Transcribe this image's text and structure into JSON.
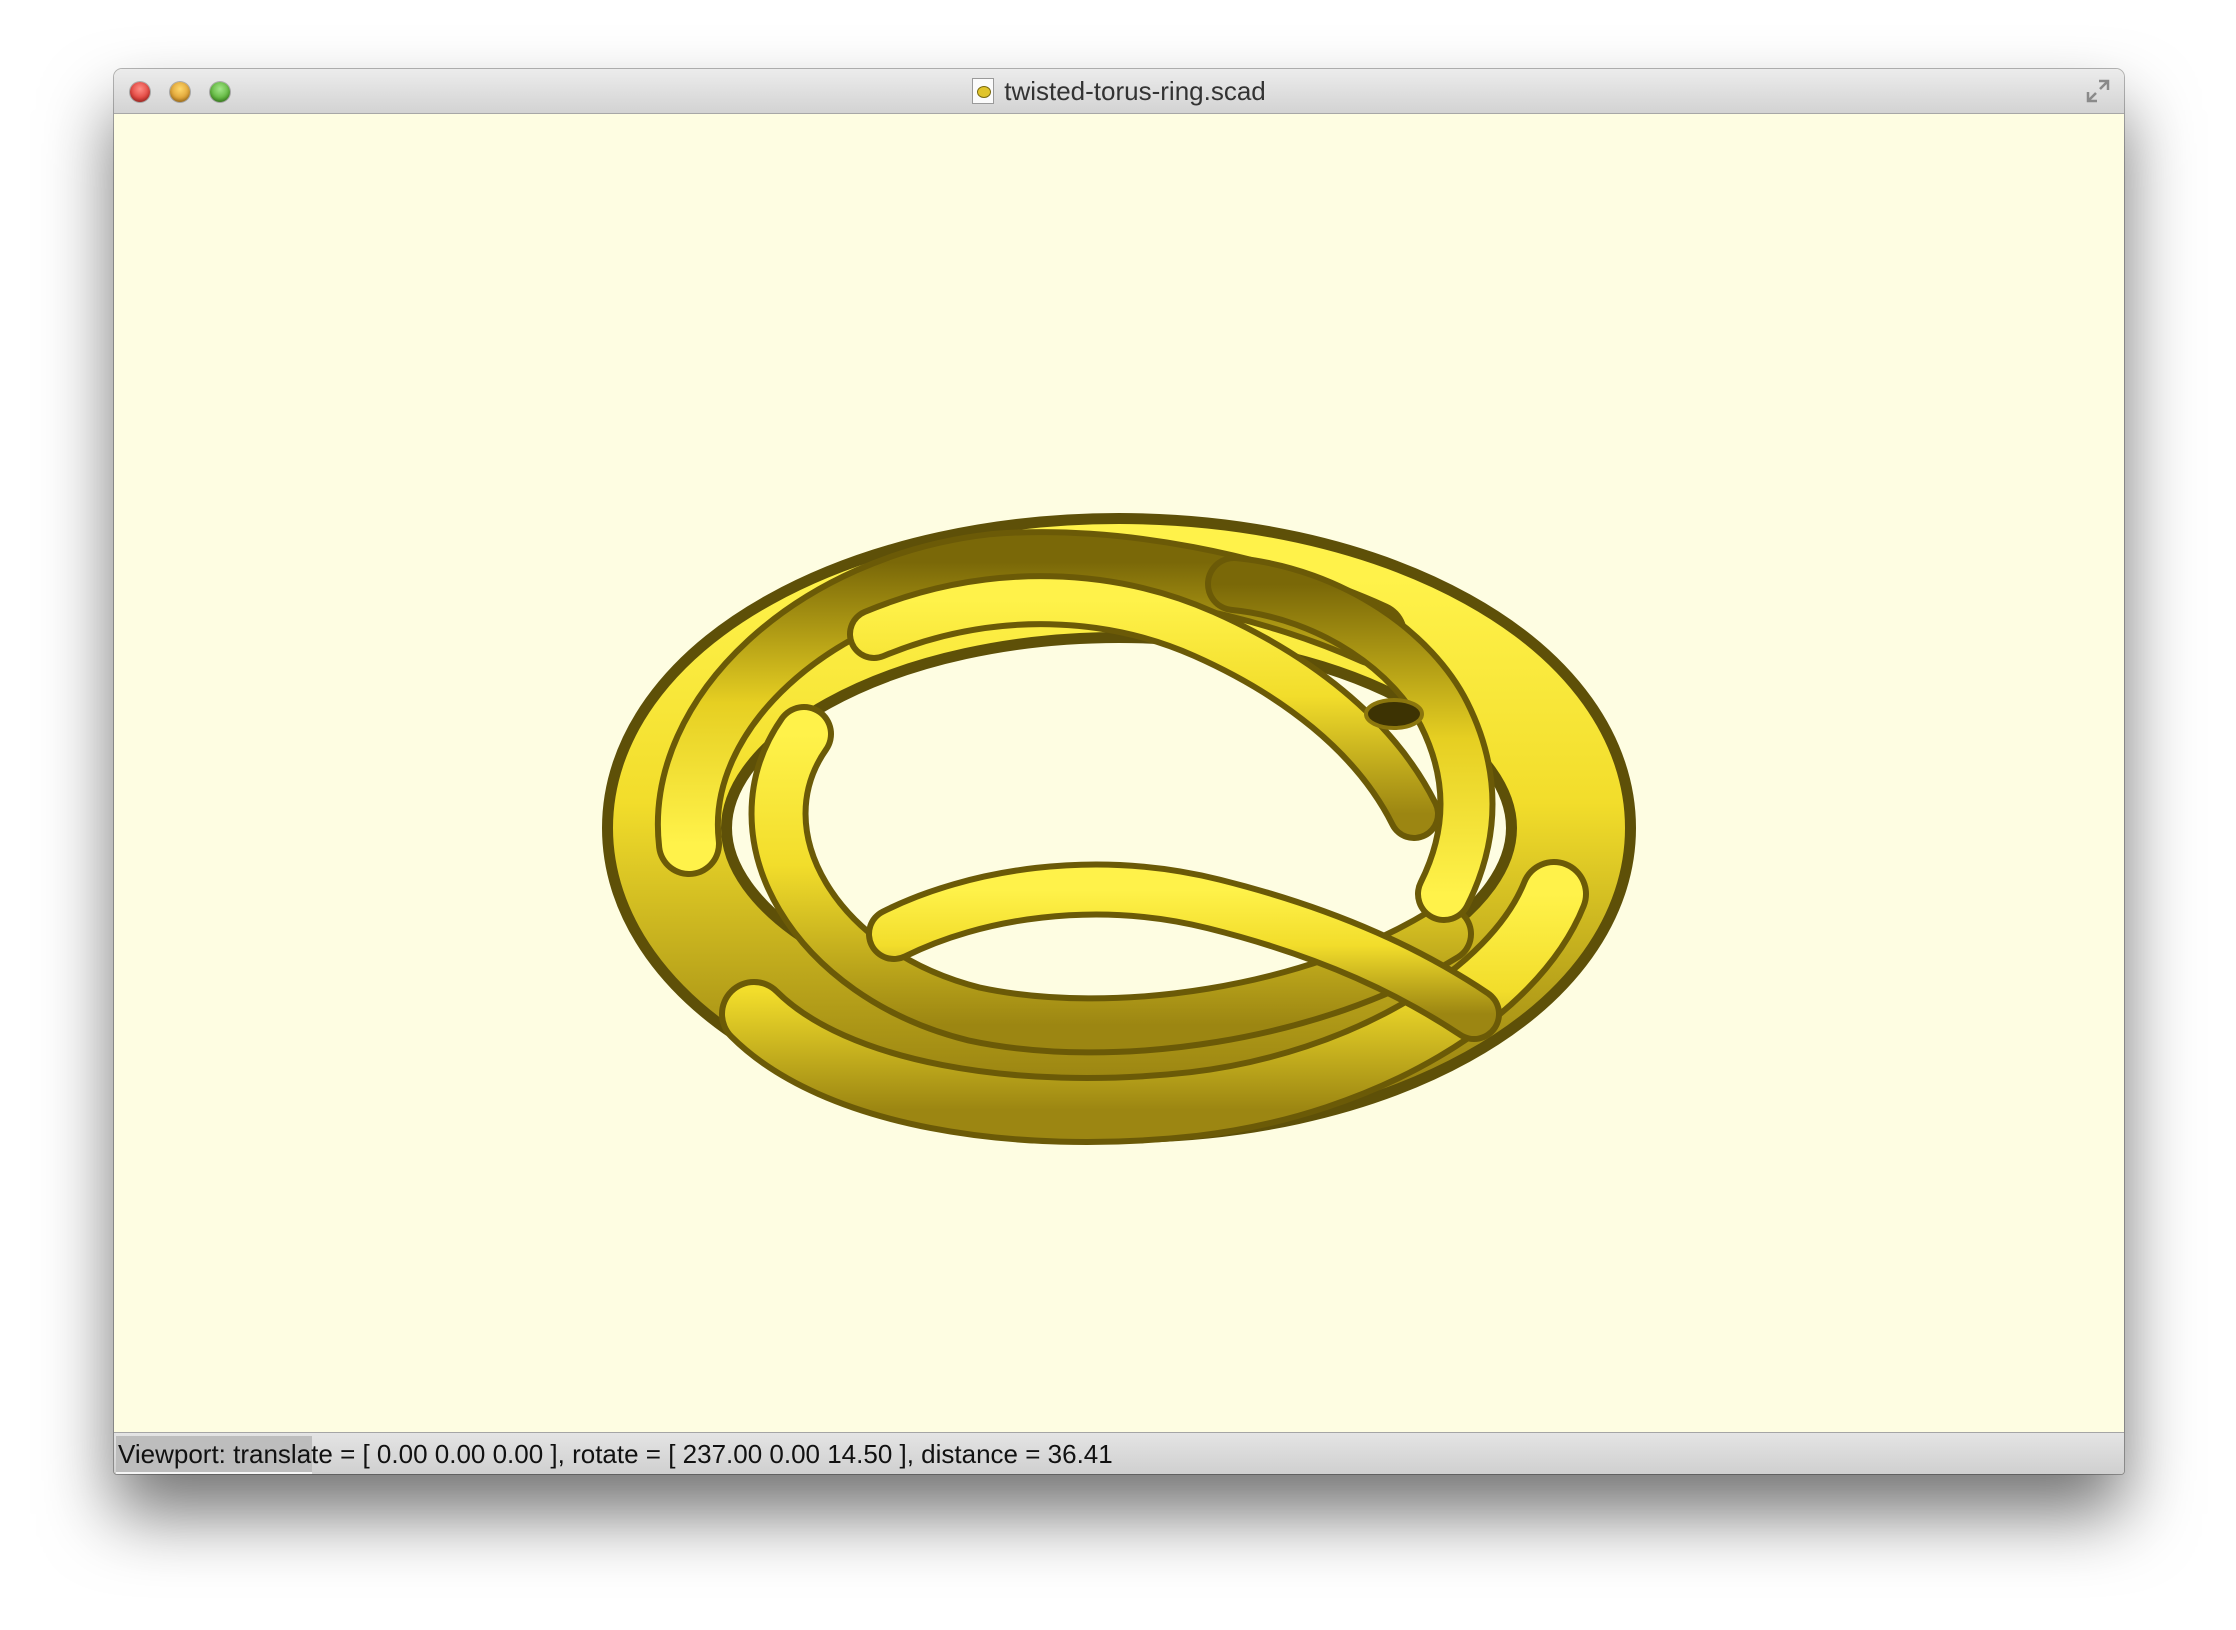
{
  "window": {
    "title": "twisted-torus-ring.scad",
    "model_color": "#f2dd2b",
    "viewport_background": "#fefde2"
  },
  "icons": {
    "close": "close-button",
    "minimize": "minimize-button",
    "zoom": "zoom-button",
    "document": "scad-file-icon",
    "fullscreen": "fullscreen-arrows-icon"
  },
  "status": {
    "text": "Viewport: translate = [ 0.00 0.00 0.00 ], rotate = [ 237.00 0.00 14.50 ], distance = 36.41"
  }
}
